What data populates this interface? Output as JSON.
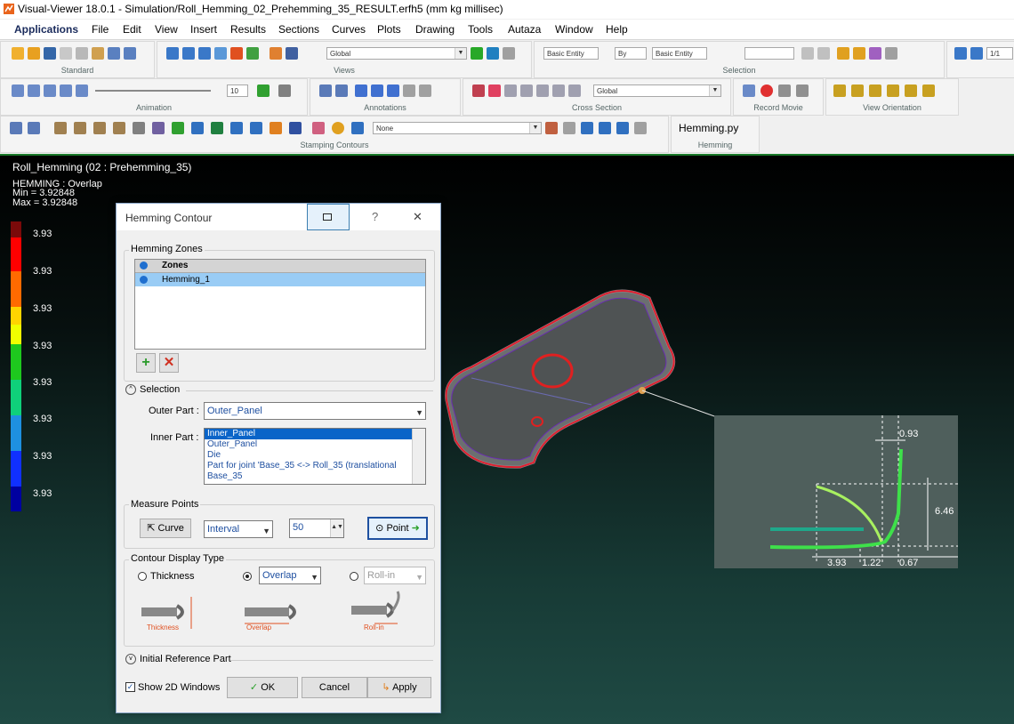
{
  "window": {
    "title": "Visual-Viewer 18.0.1 - Simulation/Roll_Hemming_02_Prehemming_35_RESULT.erfh5 (mm kg millisec)"
  },
  "menu": [
    "Applications",
    "File",
    "Edit",
    "View",
    "Insert",
    "Results",
    "Sections",
    "Curves",
    "Plots",
    "Drawing",
    "Tools",
    "Autaza",
    "Window",
    "Help"
  ],
  "toolbar": {
    "groups": {
      "standard": "Standard",
      "views": "Views",
      "selection": "Selection",
      "animation": "Animation",
      "annotations": "Annotations",
      "cross_section": "Cross Section",
      "record_movie": "Record Movie",
      "view_orientation": "View Orientation",
      "stamping_contours": "Stamping Contours",
      "hemming": "Hemming"
    },
    "views_combo": "Global",
    "sel_combo1": "Basic Entity",
    "sel_combo2": "By",
    "sel_combo3": "Basic Entity",
    "page": "1/1",
    "anim_value": "10",
    "cross_combo": "Global",
    "stamping_combo": "None",
    "hemming_button": "Hemming.py"
  },
  "viewport": {
    "model_title": "Roll_Hemming (02 : Prehemming_35)",
    "result_name": "HEMMING : Overlap",
    "min": "Min = 3.92848",
    "max": "Max = 3.92848",
    "legend_values": [
      "3.93",
      "3.93",
      "3.93",
      "3.93",
      "3.93",
      "3.93",
      "3.93",
      "3.93"
    ],
    "legend_colors": [
      "#7a0a0a",
      "#ff0000",
      "#ff6a00",
      "#ffd400",
      "#f0ff00",
      "#1ec81e",
      "#0fd07a",
      "#1e90e0",
      "#1030ff",
      "#0000a0"
    ]
  },
  "dialog": {
    "title": "Hemming Contour",
    "help": "?",
    "close": "✕",
    "zones_label": "Hemming Zones",
    "zones_header": "Zones",
    "zones": [
      "Hemming_1"
    ],
    "selection_label": "Selection",
    "outer_part_label": "Outer Part :",
    "outer_part_value": "Outer_Panel",
    "inner_part_label": "Inner Part :",
    "inner_part_items": [
      "Inner_Panel",
      "Outer_Panel",
      "Die",
      "Part for joint 'Base_35 <-> Roll_35 (translational",
      "Base_35"
    ],
    "measure_points_label": "Measure Points",
    "curve_btn": "Curve",
    "interval_value": "Interval",
    "interval_number": "50",
    "point_btn": "Point",
    "contour_type_label": "Contour Display Type",
    "thickness_label": "Thickness",
    "overlap_value": "Overlap",
    "rollin_value": "Roll-in",
    "img_thickness": "Thickness",
    "img_overlap": "Overlap",
    "img_rollin": "Roll-in",
    "initial_ref_label": "Initial Reference Part",
    "show2d_label": "Show 2D Windows",
    "ok": "OK",
    "cancel": "Cancel",
    "apply": "Apply"
  },
  "inset": {
    "d1": "0.93",
    "d2": "6.46",
    "d3": "3.93",
    "d4": "1.22",
    "d5": "0.67"
  }
}
